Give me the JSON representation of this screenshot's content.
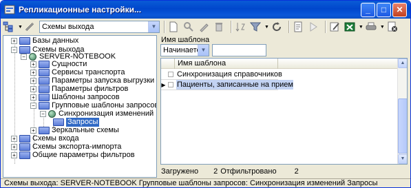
{
  "window": {
    "title": "Репликационные настройки..."
  },
  "toolbar": {
    "scheme_combo_value": "Схемы выхода"
  },
  "tree": {
    "nodes": [
      {
        "label": "Базы данных"
      },
      {
        "label": "Схемы выхода"
      },
      {
        "label": "SERVER-NOTEBOOK"
      },
      {
        "label": "Сущности"
      },
      {
        "label": "Сервисы транспорта"
      },
      {
        "label": "Параметры запуска выгрузки данных"
      },
      {
        "label": "Параметры фильтров"
      },
      {
        "label": "Шаблоны запросов"
      },
      {
        "label": "Групповые шаблоны запросов"
      },
      {
        "label": "Синхронизация изменений"
      },
      {
        "label": "Запросы"
      },
      {
        "label": "Зеркальные схемы"
      },
      {
        "label": "Схемы входа"
      },
      {
        "label": "Схемы экспорта-импорта"
      },
      {
        "label": "Общие параметры фильтров"
      }
    ]
  },
  "filter": {
    "label": "Имя шаблона",
    "mode": "Начинается",
    "value": ""
  },
  "grid": {
    "column": "Имя шаблона",
    "rows": [
      {
        "name": "Синхронизация справочников"
      },
      {
        "name": "Пациенты, записанные на прием"
      }
    ]
  },
  "counts": {
    "loaded_label": "Загружено",
    "loaded_value": "2",
    "filtered_label": "Отфильтровано",
    "filtered_value": "2"
  },
  "status": {
    "text": "Схемы выхода: SERVER-NOTEBOOK Групповые шаблоны запросов: Синхронизация изменений Запросы"
  },
  "colors": {
    "titlebar": "#0a5bd6",
    "selection": "#316ac5",
    "row_highlight": "#c3d3f3"
  }
}
